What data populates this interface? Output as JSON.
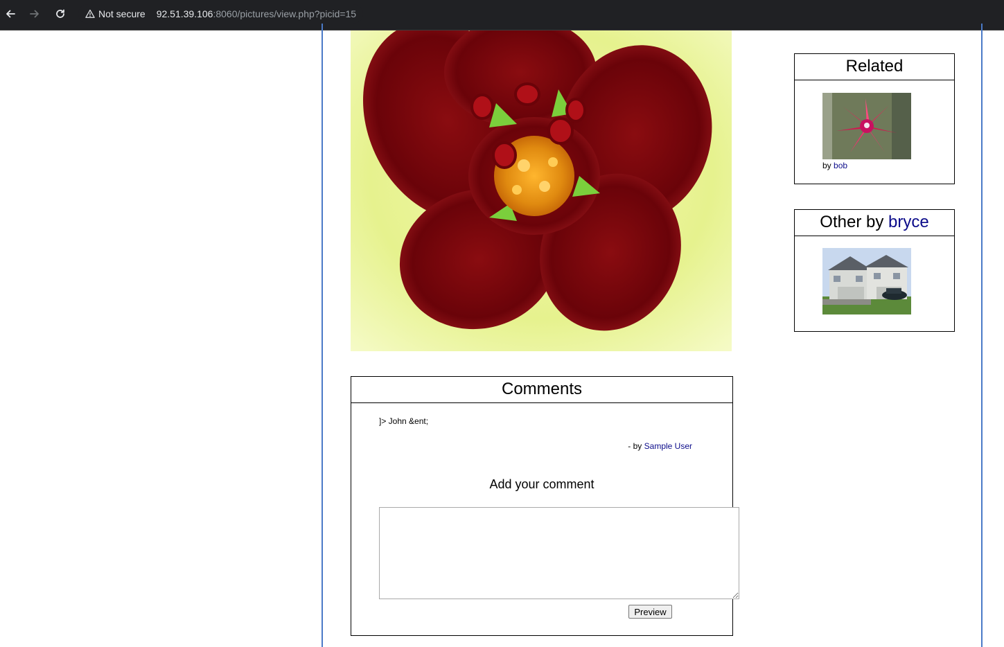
{
  "browser": {
    "security_label": "Not secure",
    "url_host": "92.51.39.106",
    "url_path": ":8060/pictures/view.php?picid=15"
  },
  "related": {
    "title": "Related",
    "by_prefix": "by",
    "author": "bob"
  },
  "other": {
    "title_prefix": "Other by",
    "author": "bryce"
  },
  "comments": {
    "title": "Comments",
    "comment_text": "]> John &ent;",
    "comment_by_prefix": "- by",
    "comment_author": "Sample User",
    "add_heading": "Add your comment",
    "textarea_value": "",
    "preview_label": "Preview"
  },
  "colors": {
    "link": "#0b0b8a",
    "frame_border": "#4a7ac7",
    "chrome_bg": "#202124"
  }
}
